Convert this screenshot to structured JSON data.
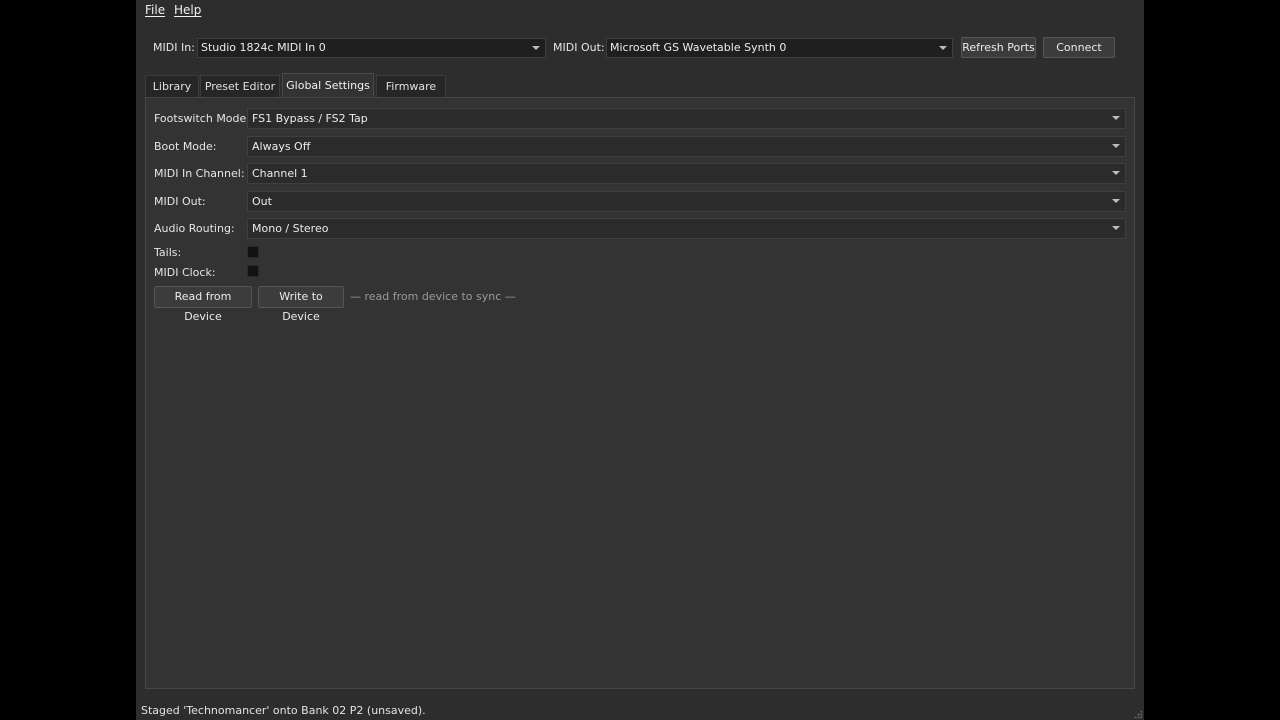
{
  "menu": {
    "file": "File",
    "help": "Help"
  },
  "ports": {
    "midi_in_label": "MIDI In:",
    "midi_in_value": "Studio 1824c MIDI In 0",
    "midi_out_label": "MIDI Out:",
    "midi_out_value": "Microsoft GS Wavetable Synth 0",
    "refresh_label": "Refresh Ports",
    "connect_label": "Connect"
  },
  "tabs": [
    {
      "label": "Library"
    },
    {
      "label": "Preset Editor"
    },
    {
      "label": "Global Settings",
      "active": true
    },
    {
      "label": "Firmware"
    }
  ],
  "global_settings": {
    "footswitch_mode_label": "Footswitch Mode:",
    "footswitch_mode_value": "FS1 Bypass / FS2 Tap",
    "boot_mode_label": "Boot Mode:",
    "boot_mode_value": "Always Off",
    "midi_in_channel_label": "MIDI In Channel:",
    "midi_in_channel_value": "Channel 1",
    "midi_out_label": "MIDI Out:",
    "midi_out_value": "Out",
    "audio_routing_label": "Audio Routing:",
    "audio_routing_value": "Mono / Stereo",
    "tails_label": "Tails:",
    "tails_checked": false,
    "midi_clock_label": "MIDI Clock:",
    "midi_clock_checked": false,
    "read_button": "Read from Device",
    "write_button": "Write to Device",
    "sync_hint": "— read from device to sync —"
  },
  "status": {
    "text": "Staged 'Technomancer' onto Bank 02  P2 (unsaved)."
  },
  "colors": {
    "window_bg": "#2d2d2d",
    "panel_bg": "#333333",
    "field_bg": "#2b2b2b",
    "text": "#e6e6e6",
    "hint_text": "#9a9a9a"
  }
}
